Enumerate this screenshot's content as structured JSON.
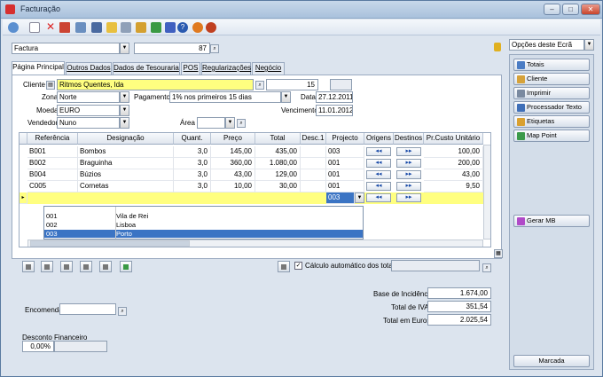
{
  "window": {
    "title": "Facturação"
  },
  "doc_type": {
    "value": "Factura",
    "number": "87"
  },
  "options_select": {
    "value": "Opções deste Ecrã"
  },
  "tabs": [
    {
      "label": "Página Principal"
    },
    {
      "label": "Outros Dados"
    },
    {
      "label": "Dados de Tesouraria"
    },
    {
      "label": "POS"
    },
    {
      "label": "Regularizações"
    },
    {
      "label": "Negócio"
    }
  ],
  "form": {
    "cliente_label": "Cliente",
    "cliente_value": "Ritmos Quentes, lda",
    "cliente_code": "15",
    "zona_label": "Zona",
    "zona_value": "Norte",
    "pagamento_label": "Pagamento",
    "pagamento_value": "1% nos primeiros 15 dias",
    "data_label": "Data",
    "data_value": "27.12.2011",
    "moeda_label": "Moeda",
    "moeda_value": "EURO",
    "vencimento_label": "Vencimento",
    "vencimento_value": "11.01.2012",
    "vendedor_label": "Vendedor",
    "vendedor_value": "Nuno",
    "area_label": "Área",
    "area_value": ""
  },
  "grid": {
    "headers": [
      "Referência",
      "Designação",
      "Quant.",
      "Preço",
      "Total",
      "Desc.1",
      "Projecto",
      "Origens",
      "Destinos",
      "Pr.Custo Unitário"
    ],
    "rows": [
      {
        "ref": "B001",
        "des": "Bombos",
        "qty": "3,0",
        "price": "145,00",
        "total": "435,00",
        "desc": "",
        "proj": "003",
        "cost": "100,00"
      },
      {
        "ref": "B002",
        "des": "Braguinha",
        "qty": "3,0",
        "price": "360,00",
        "total": "1.080,00",
        "desc": "",
        "proj": "001",
        "cost": "200,00"
      },
      {
        "ref": "B004",
        "des": "Búzios",
        "qty": "3,0",
        "price": "43,00",
        "total": "129,00",
        "desc": "",
        "proj": "001",
        "cost": "43,00"
      },
      {
        "ref": "C005",
        "des": "Cornetas",
        "qty": "3,0",
        "price": "10,00",
        "total": "30,00",
        "desc": "",
        "proj": "001",
        "cost": "9,50"
      }
    ],
    "edit_row_project": "003",
    "nav_left": "◂◂",
    "nav_right": "▸▸"
  },
  "project_dropdown": {
    "items": [
      {
        "code": "001",
        "name": "Vila de Rei"
      },
      {
        "code": "002",
        "name": "Lisboa"
      },
      {
        "code": "003",
        "name": "Porto"
      }
    ],
    "selected": "003"
  },
  "auto_calc": {
    "label": "Cálculo automático dos totais",
    "checked": "✓"
  },
  "totals": {
    "base_label": "Base de Incidência",
    "base_value": "1.674,00",
    "iva_label": "Total de IVA",
    "iva_value": "351,54",
    "euros_label": "Total em Euros",
    "euros_value": "2.025,54"
  },
  "encomenda": {
    "label": "Encomenda",
    "value": ""
  },
  "desconto": {
    "label": "Desconto Financeiro",
    "value": "0,00%"
  },
  "right_buttons": [
    {
      "label": "Totais",
      "color": "#4a7cc4"
    },
    {
      "label": "Cliente",
      "color": "#d6a23a"
    },
    {
      "label": "Imprimir",
      "color": "#7a8aa0"
    },
    {
      "label": "Processador Texto",
      "color": "#3f6fb8"
    },
    {
      "label": "Etiquetas",
      "color": "#d9a030"
    },
    {
      "label": "Map Point",
      "color": "#3b9a4a"
    }
  ],
  "gerar_mb": {
    "label": "Gerar MB",
    "color": "#b04ac8"
  },
  "marcada": {
    "label": "Marcada"
  }
}
